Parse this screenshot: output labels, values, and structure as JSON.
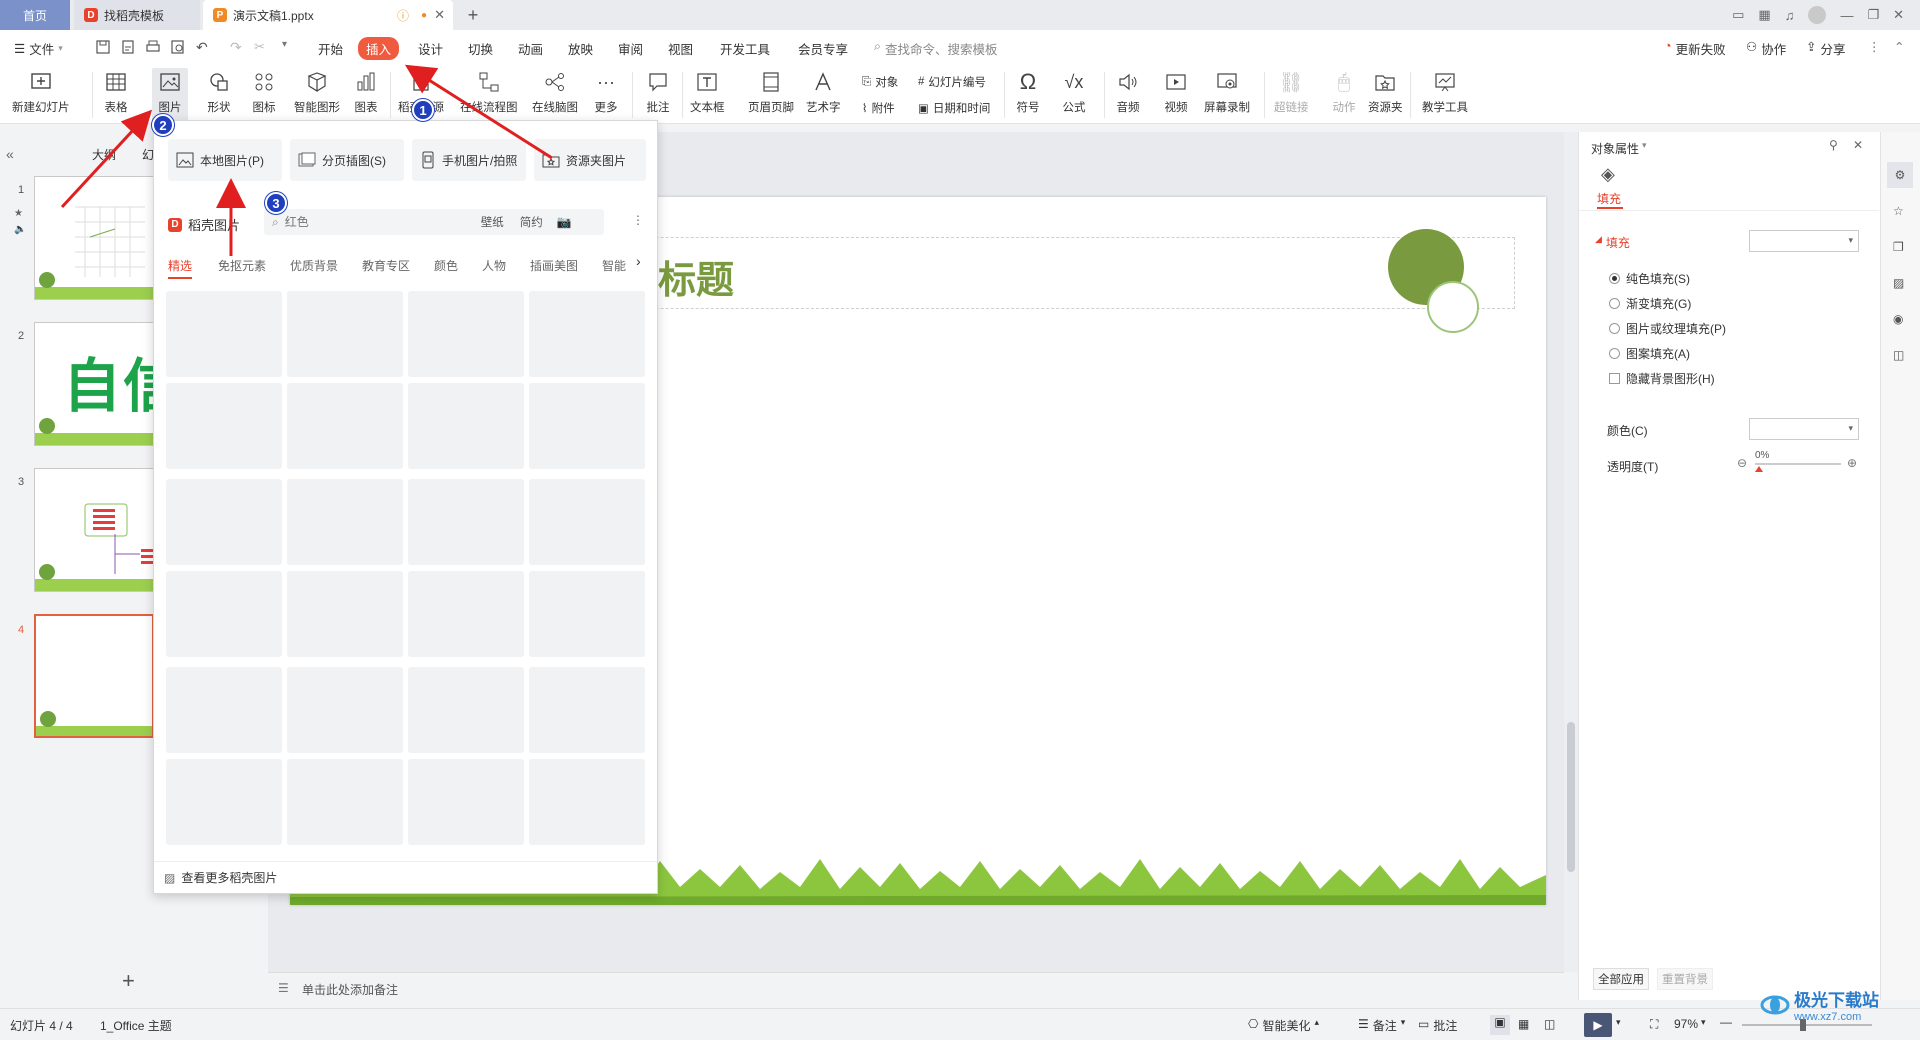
{
  "titlebar": {
    "tabs": [
      {
        "label": "首页"
      },
      {
        "label": "找稻壳模板"
      },
      {
        "label": "演示文稿1.pptx"
      }
    ],
    "new_tab": "+"
  },
  "menubar": {
    "file": "文件",
    "items": [
      "开始",
      "插入",
      "设计",
      "切换",
      "动画",
      "放映",
      "审阅",
      "视图",
      "开发工具",
      "会员专享"
    ],
    "active": "插入",
    "search_placeholder": "查找命令、搜索模板",
    "update_failed": "更新失败",
    "collab": "协作",
    "share": "分享"
  },
  "ribbon": {
    "new_slide": "新建幻灯片",
    "table": "表格",
    "picture": "图片",
    "shape": "形状",
    "icon": "图标",
    "smart_shape": "智能图形",
    "chart": "图表",
    "docer_resources": "稻壳资源",
    "flowchart": "在线流程图",
    "mindmap": "在线脑图",
    "more": "更多",
    "comment": "批注",
    "textbox": "文本框",
    "header_footer": "页眉页脚",
    "wordart": "艺术字",
    "object": "对象",
    "slide_number": "幻灯片编号",
    "attachment": "附件",
    "datetime": "日期和时间",
    "symbol": "符号",
    "formula": "公式",
    "audio": "音频",
    "video": "视频",
    "screen_record": "屏幕录制",
    "hyperlink": "超链接",
    "action": "动作",
    "resource_folder": "资源夹",
    "teaching_tool": "教学工具"
  },
  "left_panel": {
    "tab_outline": "大纲",
    "tab_slides": "幻灯片",
    "slide_numbers": [
      "1",
      "2",
      "3",
      "4"
    ],
    "slide2_text": "自信",
    "add": "+"
  },
  "picture_popup": {
    "local_picture": "本地图片(P)",
    "page_insert": "分页插图(S)",
    "phone_picture": "手机图片/拍照",
    "folder_picture": "资源夹图片",
    "docer_title": "稻壳图片",
    "search_placeholder": "红色",
    "tag_wallpaper": "壁纸",
    "tag_simple": "简约",
    "categories": [
      "精选",
      "免抠元素",
      "优质背景",
      "教育专区",
      "颜色",
      "人物",
      "插画美图",
      "智能"
    ],
    "more_link": "查看更多稻壳图片"
  },
  "slide": {
    "title_fragment": "标题"
  },
  "notes": {
    "placeholder": "单击此处添加备注"
  },
  "right_panel": {
    "header": "对象属性",
    "tab_fill": "填充",
    "section_fill": "填充",
    "options": [
      "纯色填充(S)",
      "渐变填充(G)",
      "图片或纹理填充(P)",
      "图案填充(A)"
    ],
    "selected_option": "纯色填充(S)",
    "hide_bg": "隐藏背景图形(H)",
    "color_label": "颜色(C)",
    "transparency_label": "透明度(T)",
    "transparency_value": "0%",
    "apply_all": "全部应用",
    "reset_bg": "重置背景"
  },
  "statusbar": {
    "slide_info": "幻灯片 4 / 4",
    "theme": "1_Office 主题",
    "smart_beautify": "智能美化",
    "notes": "备注",
    "comments": "批注",
    "zoom": "97%"
  },
  "annotations": [
    "1",
    "2",
    "3"
  ],
  "watermark": {
    "brand": "极光下载站",
    "url": "www.xz7.com"
  },
  "colors": {
    "accent": "#f05a3e",
    "home_tab": "#7a92c9",
    "badge": "#1f3fbf",
    "arrow": "#e02020",
    "slide_green": "#7a9a3f"
  }
}
